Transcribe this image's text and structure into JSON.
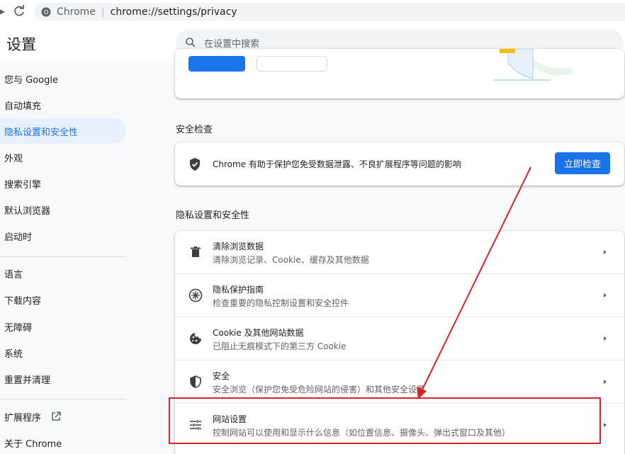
{
  "browser": {
    "site_name": "Chrome",
    "url": "chrome://settings/privacy"
  },
  "header": {
    "title": "设置",
    "search_placeholder": "在设置中搜索"
  },
  "sidebar": {
    "items": [
      {
        "label": "您与 Google"
      },
      {
        "label": "自动填充"
      },
      {
        "label": "隐私设置和安全性",
        "active": true
      },
      {
        "label": "外观"
      },
      {
        "label": "搜索引擎"
      },
      {
        "label": "默认浏览器"
      },
      {
        "label": "启动时"
      },
      {
        "label": "语言"
      },
      {
        "label": "下载内容"
      },
      {
        "label": "无障碍"
      },
      {
        "label": "系统"
      },
      {
        "label": "重置并清理"
      },
      {
        "label": "扩展程序"
      },
      {
        "label": "关于 Chrome"
      }
    ]
  },
  "safety_check": {
    "section_title": "安全检查",
    "text": "Chrome 有助于保护您免受数据泄露、不良扩展程序等问题的影响",
    "button_label": "立即检查"
  },
  "privacy": {
    "section_title": "隐私设置和安全性",
    "rows": [
      {
        "title": "清除浏览数据",
        "subtitle": "清除浏览记录、Cookie、缓存及其他数据",
        "icon": "trash-icon"
      },
      {
        "title": "隐私保护指南",
        "subtitle": "检查重要的隐私控制设置和安全控件",
        "icon": "privacy-guide-icon"
      },
      {
        "title": "Cookie 及其他网站数据",
        "subtitle": "已阻止无痕模式下的第三方 Cookie",
        "icon": "cookie-icon"
      },
      {
        "title": "安全",
        "subtitle": "安全浏览（保护您免受危险网站的侵害）和其他安全设置",
        "icon": "security-shield-icon"
      },
      {
        "title": "网站设置",
        "subtitle": "控制网站可以使用和显示什么信息（如位置信息、摄像头、弹出式窗口及其他）",
        "icon": "tune-icon"
      }
    ]
  },
  "colors": {
    "accent": "#1a73e8",
    "annotation": "#d8232a",
    "active_nav_bg": "#e8f0fe"
  }
}
